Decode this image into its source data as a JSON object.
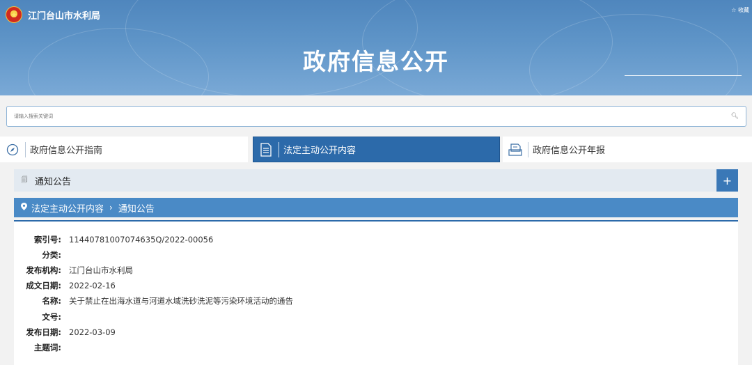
{
  "header": {
    "org_name": "江门台山市水利局",
    "favorite": "收藏",
    "title": "政府信息公开"
  },
  "search": {
    "placeholder": "请输入搜索关键词"
  },
  "tabs": [
    {
      "label": "政府信息公开指南",
      "icon": "compass-icon"
    },
    {
      "label": "法定主动公开内容",
      "icon": "document-icon",
      "active": true
    },
    {
      "label": "政府信息公开年报",
      "icon": "report-icon"
    }
  ],
  "section": {
    "title": "通知公告",
    "expand": "+"
  },
  "breadcrumb": {
    "parent": "法定主动公开内容",
    "current": "通知公告"
  },
  "details": [
    {
      "key": "索引号:",
      "value": "11440781007074635Q/2022-00056"
    },
    {
      "key": "分类:",
      "value": ""
    },
    {
      "key": "发布机构:",
      "value": "江门台山市水利局"
    },
    {
      "key": "成文日期:",
      "value": "2022-02-16"
    },
    {
      "key": "名称:",
      "value": "关于禁止在出海水道与河道水域洗砂洗泥等污染环境活动的通告"
    },
    {
      "key": "文号:",
      "value": ""
    },
    {
      "key": "发布日期:",
      "value": "2022-03-09"
    },
    {
      "key": "主题词:",
      "value": ""
    }
  ],
  "colors": {
    "accent": "#2c6aaa",
    "banner": "#5f95c8",
    "breadcrumb": "#4a8ac6"
  }
}
